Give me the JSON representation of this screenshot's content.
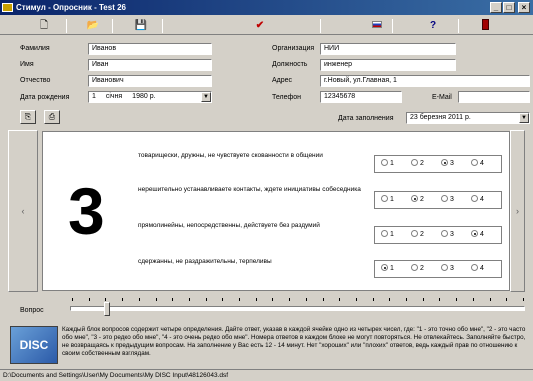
{
  "window": {
    "title": "Стимул - Опросник - Test 26"
  },
  "toolbar": {
    "icons": [
      "new-doc-icon",
      "open-folder-icon",
      "save-disk-icon",
      "checkmark-icon",
      "flag-icon",
      "help-icon",
      "exit-door-icon"
    ]
  },
  "form": {
    "surname_label": "Фамилия",
    "surname": "Иванов",
    "name_label": "Имя",
    "name": "Иван",
    "patronymic_label": "Отчество",
    "patronymic": "Иванович",
    "birth_label": "Дата рождения",
    "birth_day": "1",
    "birth_month": "січня",
    "birth_year": "1980 р.",
    "org_label": "Организация",
    "org": "НИИ",
    "position_label": "Должность",
    "position": "инженер",
    "address_label": "Адрес",
    "address": "г.Новый, ул.Главная, 1",
    "phone_label": "Телефон",
    "phone": "12345678",
    "email_label": "E-Mail",
    "email": "",
    "filldate_label": "Дата заполнения",
    "filldate": "23 березня 2011 р."
  },
  "question": {
    "block_number": "3",
    "items": [
      {
        "text": "товарищески, дружны, не чувствуете скованности в общении",
        "selected": 3
      },
      {
        "text": "нерешительно устанавливаете контакты, ждете инициативы собеседника",
        "selected": 2
      },
      {
        "text": "прямолинейны, непосредственны, действуете без раздумий",
        "selected": 4
      },
      {
        "text": "сдержанны, не раздражительны, терпеливы",
        "selected": 1
      }
    ],
    "options": [
      "1",
      "2",
      "3",
      "4"
    ]
  },
  "progress": {
    "label": "Вопрос",
    "position": 0.08
  },
  "logo_text": "DISC",
  "instructions": "Каждый блок вопросов содержит четыре определения. Дайте ответ, указав в каждой ячейке одно из четырех чисел, где: \"1 - это точно обо мне\", \"2 - это часто обо мне\", \"3 - это редко обо мне\", \"4 - это очень редко обо мне\". Номера ответов в каждом блоке не могут повторяться. Не отвлекайтесь. Заполняйте быстро, не возвращаясь к предыдущим вопросам. На заполнение у Вас есть 12 - 14 минут. Нет \"хороших\" или \"плохих\" ответов, ведь каждый прав по отношению к своим собственным взглядам.",
  "status": {
    "path": "D:\\Documents and Settings\\User\\My Documents\\My DISC Input\\48126043.dsf"
  }
}
